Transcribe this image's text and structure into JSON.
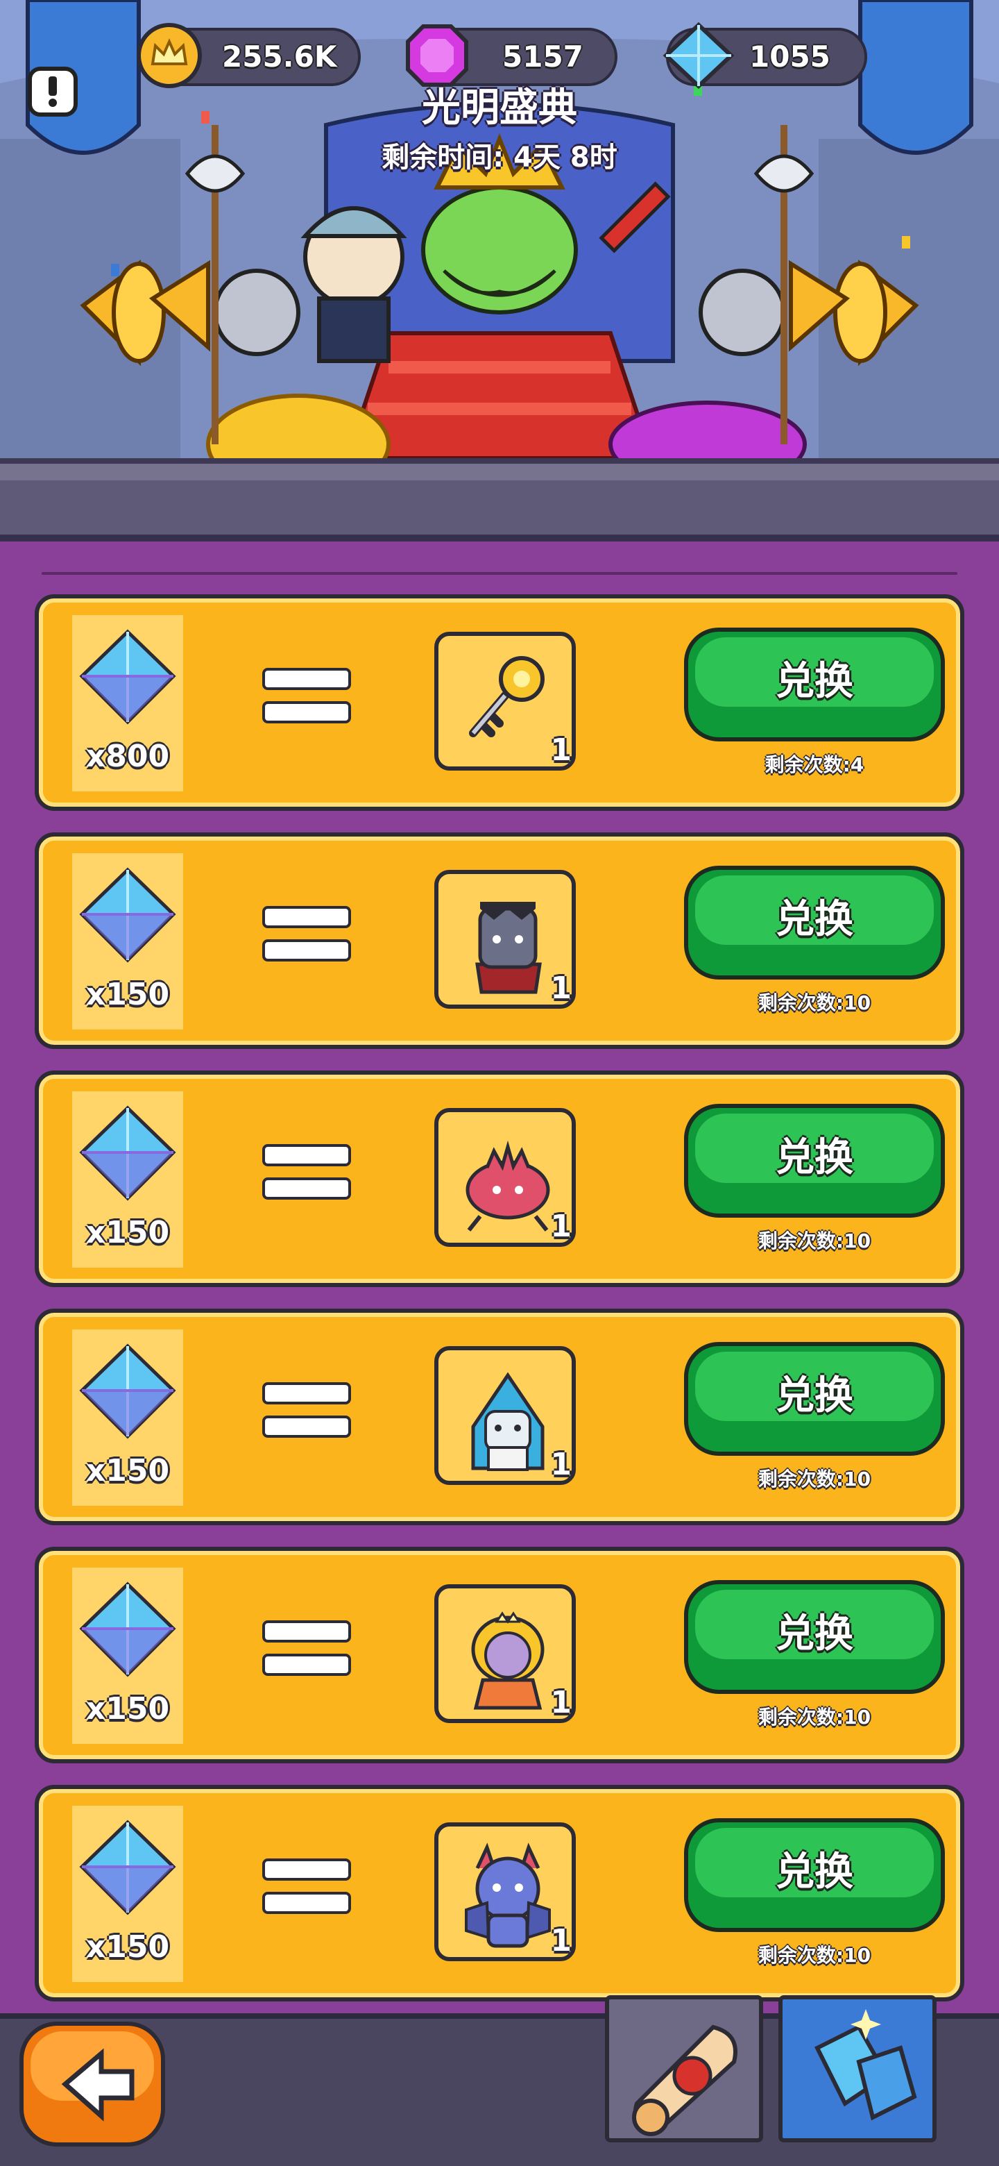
{
  "header": {
    "title": "光明盛典",
    "countdown": "剩余时间:  4天 8时"
  },
  "resources": [
    {
      "name": "crown-coin",
      "value": "255.6K"
    },
    {
      "name": "purple-gem",
      "value": "5157"
    },
    {
      "name": "blue-diamond",
      "value": "1055"
    }
  ],
  "exchange": {
    "button_label": "兑换",
    "rows": [
      {
        "cost": "x800",
        "reward_icon": "key-icon",
        "reward_count": "1",
        "remaining": "剩余次数:4"
      },
      {
        "cost": "x150",
        "reward_icon": "vampire-hero-icon",
        "reward_count": "1",
        "remaining": "剩余次数:10"
      },
      {
        "cost": "x150",
        "reward_icon": "spiky-crab-icon",
        "reward_count": "1",
        "remaining": "剩余次数:10"
      },
      {
        "cost": "x150",
        "reward_icon": "blue-hooded-mage-icon",
        "reward_count": "1",
        "remaining": "剩余次数:10"
      },
      {
        "cost": "x150",
        "reward_icon": "blonde-princess-icon",
        "reward_count": "1",
        "remaining": "剩余次数:10"
      },
      {
        "cost": "x150",
        "reward_icon": "blue-demon-icon",
        "reward_count": "1",
        "remaining": "剩余次数:10"
      }
    ]
  },
  "bottom_nav": {
    "back": "back-arrow-icon",
    "tabs": [
      "scroll-icon",
      "diamonds-icon"
    ]
  }
}
